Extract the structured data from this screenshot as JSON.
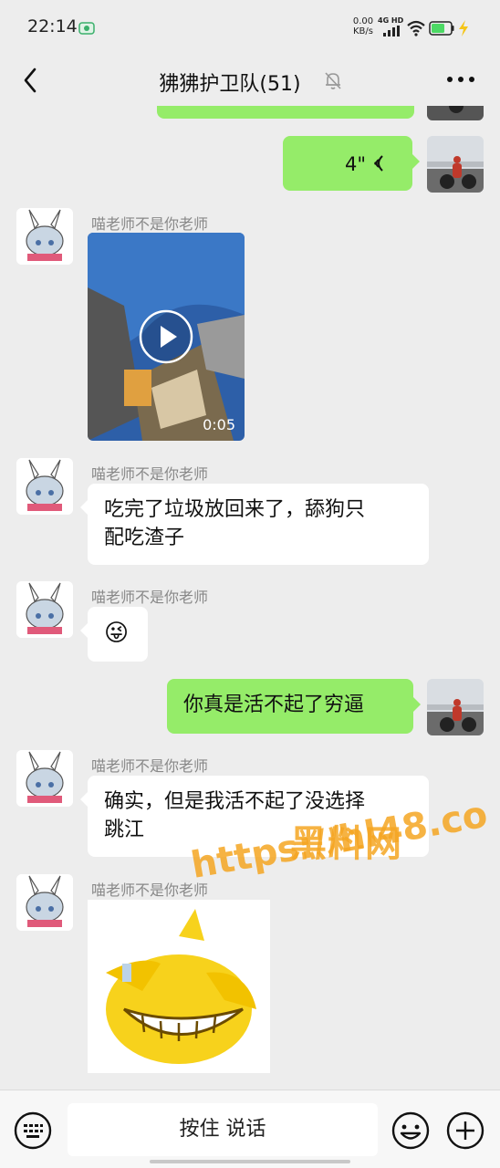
{
  "status_bar": {
    "time": "22:14",
    "speed_value": "0.00",
    "speed_unit": "KB/s",
    "network": "4G HD",
    "battery_color": "#4cd964"
  },
  "header": {
    "title": "狒狒护卫队(51)",
    "icons": [
      "back-icon",
      "mute-bell-icon",
      "more-icon"
    ]
  },
  "messages": [
    {
      "side": "right",
      "type": "voice",
      "duration": "4\""
    },
    {
      "side": "left",
      "type": "video",
      "nickname": "喵老师不是你老师",
      "duration": "0:05"
    },
    {
      "side": "left",
      "type": "text",
      "nickname": "喵老师不是你老师",
      "line1": "吃完了垃圾放回来了，舔狗只",
      "line2": "配吃渣子"
    },
    {
      "side": "left",
      "type": "emoji",
      "nickname": "喵老师不是你老师",
      "emoji": "😜"
    },
    {
      "side": "right",
      "type": "text",
      "text": "你真是活不起了穷逼"
    },
    {
      "side": "left",
      "type": "text",
      "nickname": "喵老师不是你老师",
      "line1": "确实，但是我活不起了没选择",
      "line2": "跳江"
    },
    {
      "side": "left",
      "type": "sticker",
      "nickname": "喵老师不是你老师"
    }
  ],
  "watermark": {
    "line1": "黑料网",
    "line2": "https://hl48.co",
    "color": "#f5a623"
  },
  "input_bar": {
    "hold_to_talk": "按住 说话",
    "icons": [
      "keyboard-icon",
      "emoji-icon",
      "plus-icon"
    ]
  },
  "colors": {
    "bubble_green": "#95ec69",
    "bubble_white": "#ffffff",
    "background": "#ededed"
  }
}
